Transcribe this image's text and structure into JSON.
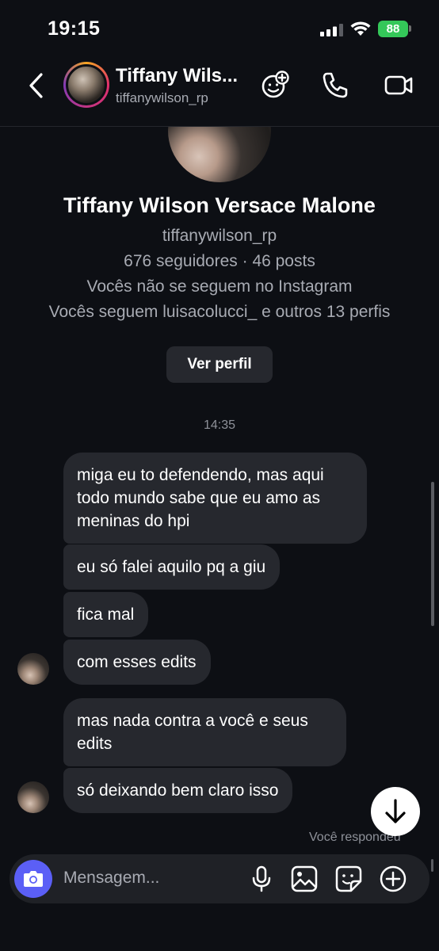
{
  "status_bar": {
    "time": "19:15",
    "battery": "88",
    "icons": [
      "signal-icon",
      "wifi-icon",
      "battery-icon"
    ]
  },
  "header": {
    "name": "Tiffany Wils...",
    "username": "tiffanywilson_rp",
    "icons": [
      "back-icon",
      "add-effect-icon",
      "phone-icon",
      "video-camera-icon"
    ]
  },
  "profile": {
    "full_name": "Tiffany Wilson Versace Malone",
    "username": "tiffanywilson_rp",
    "stats": "676 seguidores · 46 posts",
    "follow_status": "Vocês não se seguem no Instagram",
    "mutuals": "Vocês seguem luisacolucci_ e outros 13 perfis",
    "view_profile_label": "Ver perfil"
  },
  "conversation": {
    "timestamp": "14:35",
    "messages": [
      "miga eu to defendendo, mas aqui todo mundo sabe que eu amo as meninas do hpi",
      "eu só falei aquilo pq a giu",
      "fica mal",
      "com esses edits",
      "mas nada contra a você e seus edits",
      "só deixando bem claro isso"
    ],
    "replied_label": "Você respondeu"
  },
  "composer": {
    "placeholder": "Mensagem...",
    "icons": [
      "camera-icon",
      "microphone-icon",
      "image-icon",
      "sticker-icon",
      "plus-icon"
    ]
  },
  "colors": {
    "background": "#0d0f14",
    "bubble": "#26282e",
    "secondary_text": "#a8abb3",
    "accent_camera": "#5b5ff6",
    "battery_green": "#34c759"
  }
}
